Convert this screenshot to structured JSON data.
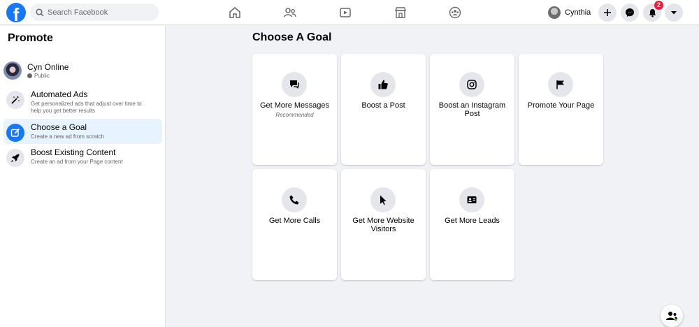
{
  "header": {
    "logo_letter": "f",
    "search": {
      "placeholder": "Search Facebook"
    },
    "nav": [
      {
        "icon": "home-icon"
      },
      {
        "icon": "friends-icon"
      },
      {
        "icon": "watch-icon"
      },
      {
        "icon": "marketplace-icon"
      },
      {
        "icon": "groups-icon"
      }
    ],
    "profile_name": "Cynthia",
    "notifications_count": "2",
    "accent_color": "#1877f2"
  },
  "sidebar": {
    "title": "Promote",
    "page": {
      "name": "Cyn Online",
      "visibility": "Public"
    },
    "items": [
      {
        "title": "Automated Ads",
        "desc": "Get personalized ads that adjust over time to help you get better results",
        "icon": "magic-wand-icon",
        "active": false
      },
      {
        "title": "Choose a Goal",
        "desc": "Create a new ad from scratch",
        "icon": "edit-icon",
        "active": true
      },
      {
        "title": "Boost Existing Content",
        "desc": "Create an ad from your Page content",
        "icon": "rocket-icon",
        "active": false
      }
    ]
  },
  "main": {
    "title": "Choose A Goal",
    "goals": [
      {
        "label": "Get More Messages",
        "sub": "Recommended",
        "icon": "message-icon"
      },
      {
        "label": "Boost a Post",
        "sub": "",
        "icon": "thumbs-up-icon"
      },
      {
        "label": "Boost an Instagram Post",
        "sub": "",
        "icon": "instagram-icon"
      },
      {
        "label": "Promote Your Page",
        "sub": "",
        "icon": "flag-icon"
      },
      {
        "label": "Get More Calls",
        "sub": "",
        "icon": "phone-icon"
      },
      {
        "label": "Get More Website Visitors",
        "sub": "",
        "icon": "cursor-icon"
      },
      {
        "label": "Get More Leads",
        "sub": "",
        "icon": "contact-card-icon"
      }
    ]
  }
}
